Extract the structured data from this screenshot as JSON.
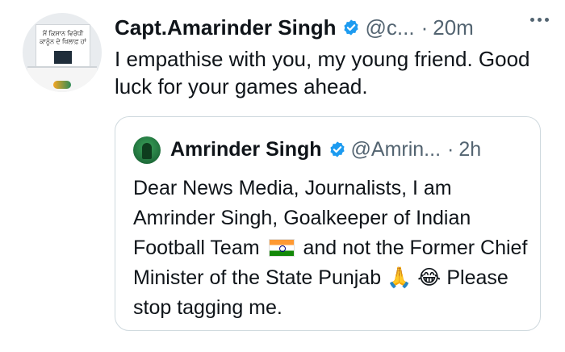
{
  "tweet": {
    "author_name": "Capt.Amarinder Singh",
    "handle": "@c...",
    "separator": "·",
    "time": "20m",
    "text": "I empathise with you, my young friend. Good luck for your games ahead.",
    "avatar_poster_text": "ਮੈਂ ਕਿਸਾਨ ਵਿਰੋਧੀ\nਕਾਨੂੰਨ ਦੇ ਖਿਲਾਫ਼ ਹਾਂ"
  },
  "quoted_tweet": {
    "author_name": "Amrinder Singh",
    "handle": "@Amrin...",
    "separator": "·",
    "time": "2h",
    "text_part1": "Dear News Media, Journalists, I am Amrinder Singh, Goalkeeper of Indian Football Team",
    "text_part2": "and not the Former Chief Minister of the State Punjab",
    "emoji_pray": "🙏",
    "emoji_laugh": "😂",
    "text_part3": "Please stop tagging me."
  },
  "icons": {
    "verified": "verified-badge-icon",
    "more": "more-options-icon",
    "flag": "india-flag-icon"
  },
  "colors": {
    "verified": "#1d9bf0",
    "secondary_text": "#536471",
    "border": "#cfd9de"
  }
}
